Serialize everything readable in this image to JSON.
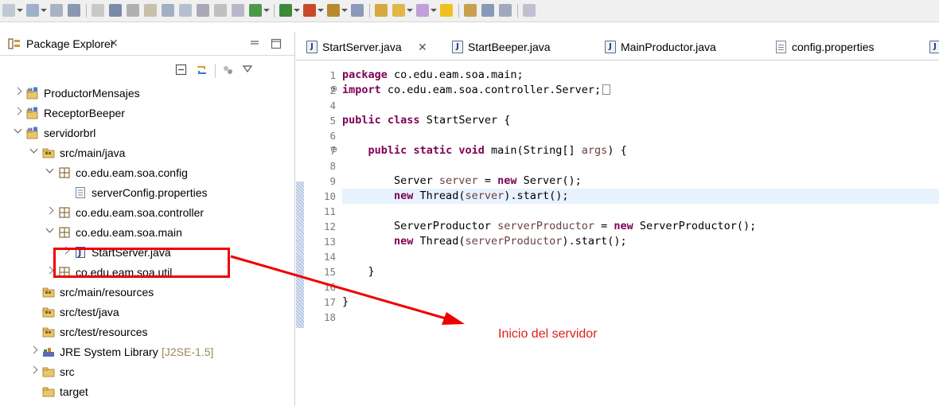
{
  "colors": {
    "keyword": "#7f0055",
    "local_var": "#6a3e3e",
    "annotation": "#e00000",
    "current_line": "#e8f2fe"
  },
  "toolbar": {
    "icons": [
      "new-icon",
      "save-icon",
      "save-all-icon",
      "search-icon",
      "debug-skip-icon",
      "pause-icon",
      "stop-icon",
      "disconnect-icon",
      "step-into-icon",
      "step-over-icon",
      "step-return-icon",
      "drop-to-frame-icon",
      "use-step-filters-icon",
      "debug-icon",
      "run-icon",
      "external-tools-icon",
      "open-type-icon",
      "new-server-icon",
      "open-folder-icon",
      "edit-icon",
      "pin-icon",
      "highlight-icon",
      "task-icon",
      "annotation-icon",
      "toggle-icon",
      "show-whitespace-icon"
    ]
  },
  "package_explorer": {
    "title": "Package Explorer",
    "tree": [
      {
        "label": "ProductorMensajes",
        "icon": "maven-project-icon",
        "state": "closed",
        "depth": 0
      },
      {
        "label": "ReceptorBeeper",
        "icon": "maven-project-icon",
        "state": "closed",
        "depth": 0
      },
      {
        "label": "servidorbrl",
        "icon": "maven-project-icon",
        "state": "open",
        "depth": 0
      },
      {
        "label": "src/main/java",
        "icon": "source-folder-icon",
        "state": "open",
        "depth": 1
      },
      {
        "label": "co.edu.eam.soa.config",
        "icon": "package-icon",
        "state": "open",
        "depth": 2
      },
      {
        "label": "serverConfig.properties",
        "icon": "properties-file-icon",
        "state": "none",
        "depth": 3
      },
      {
        "label": "co.edu.eam.soa.controller",
        "icon": "package-icon",
        "state": "closed",
        "depth": 2
      },
      {
        "label": "co.edu.eam.soa.main",
        "icon": "package-icon",
        "state": "open",
        "depth": 2
      },
      {
        "label": "StartServer.java",
        "icon": "java-file-icon",
        "state": "closed",
        "depth": 3
      },
      {
        "label": "co.edu.eam.soa.util",
        "icon": "package-icon",
        "state": "closed",
        "depth": 2
      },
      {
        "label": "src/main/resources",
        "icon": "source-folder-icon",
        "state": "none",
        "depth": 1
      },
      {
        "label": "src/test/java",
        "icon": "source-folder-icon",
        "state": "none",
        "depth": 1
      },
      {
        "label": "src/test/resources",
        "icon": "source-folder-icon",
        "state": "none",
        "depth": 1
      },
      {
        "label": "JRE System Library",
        "decoration": "[J2SE-1.5]",
        "icon": "library-icon",
        "state": "closed",
        "depth": 1
      },
      {
        "label": "src",
        "icon": "folder-icon",
        "state": "closed",
        "depth": 1
      },
      {
        "label": "target",
        "icon": "folder-icon",
        "state": "none",
        "depth": 1
      }
    ]
  },
  "editor": {
    "tabs": [
      {
        "label": "StartServer.java",
        "active": true
      },
      {
        "label": "StartBeeper.java",
        "active": false
      },
      {
        "label": "MainProductor.java",
        "active": false
      },
      {
        "label": "config.properties",
        "active": false
      }
    ],
    "current_line": 10,
    "lines": [
      {
        "n": "1",
        "tokens": [
          [
            "kw",
            "package"
          ],
          [
            "t",
            " co.edu.eam.soa.main;"
          ]
        ]
      },
      {
        "n": "2",
        "fold": "⊕",
        "collapsed": true,
        "tokens": [
          [
            "kw",
            "import"
          ],
          [
            "t",
            " co.edu.eam.soa.controller.Server;"
          ]
        ]
      },
      {
        "n": "4",
        "tokens": []
      },
      {
        "n": "5",
        "tokens": [
          [
            "kw",
            "public"
          ],
          [
            "t",
            " "
          ],
          [
            "kw",
            "class"
          ],
          [
            "t",
            " StartServer {"
          ]
        ]
      },
      {
        "n": "6",
        "tokens": []
      },
      {
        "n": "7",
        "fold": "⊖",
        "tokens": [
          [
            "t",
            "    "
          ],
          [
            "kw",
            "public"
          ],
          [
            "t",
            " "
          ],
          [
            "kw",
            "static"
          ],
          [
            "t",
            " "
          ],
          [
            "kw",
            "void"
          ],
          [
            "t",
            " main(String[] "
          ],
          [
            "lv",
            "args"
          ],
          [
            "t",
            ") {"
          ]
        ]
      },
      {
        "n": "8",
        "tokens": []
      },
      {
        "n": "9",
        "tokens": [
          [
            "t",
            "        Server "
          ],
          [
            "lv",
            "server"
          ],
          [
            "t",
            " = "
          ],
          [
            "kw",
            "new"
          ],
          [
            "t",
            " Server();"
          ]
        ]
      },
      {
        "n": "10",
        "tokens": [
          [
            "t",
            "        "
          ],
          [
            "kw",
            "new"
          ],
          [
            "t",
            " Thread("
          ],
          [
            "lv",
            "server"
          ],
          [
            "t",
            ").start();"
          ]
        ]
      },
      {
        "n": "11",
        "tokens": []
      },
      {
        "n": "12",
        "tokens": [
          [
            "t",
            "        ServerProductor "
          ],
          [
            "lv",
            "serverProductor"
          ],
          [
            "t",
            " = "
          ],
          [
            "kw",
            "new"
          ],
          [
            "t",
            " ServerProductor();"
          ]
        ]
      },
      {
        "n": "13",
        "tokens": [
          [
            "t",
            "        "
          ],
          [
            "kw",
            "new"
          ],
          [
            "t",
            " Thread("
          ],
          [
            "lv",
            "serverProductor"
          ],
          [
            "t",
            ").start();"
          ]
        ]
      },
      {
        "n": "14",
        "tokens": []
      },
      {
        "n": "15",
        "tokens": [
          [
            "t",
            "    }"
          ]
        ]
      },
      {
        "n": "16",
        "tokens": []
      },
      {
        "n": "17",
        "tokens": [
          [
            "t",
            "}"
          ]
        ]
      },
      {
        "n": "18",
        "tokens": []
      }
    ]
  },
  "annotation": {
    "label": "Inicio del servidor",
    "highlighted_item": "StartServer.java"
  }
}
